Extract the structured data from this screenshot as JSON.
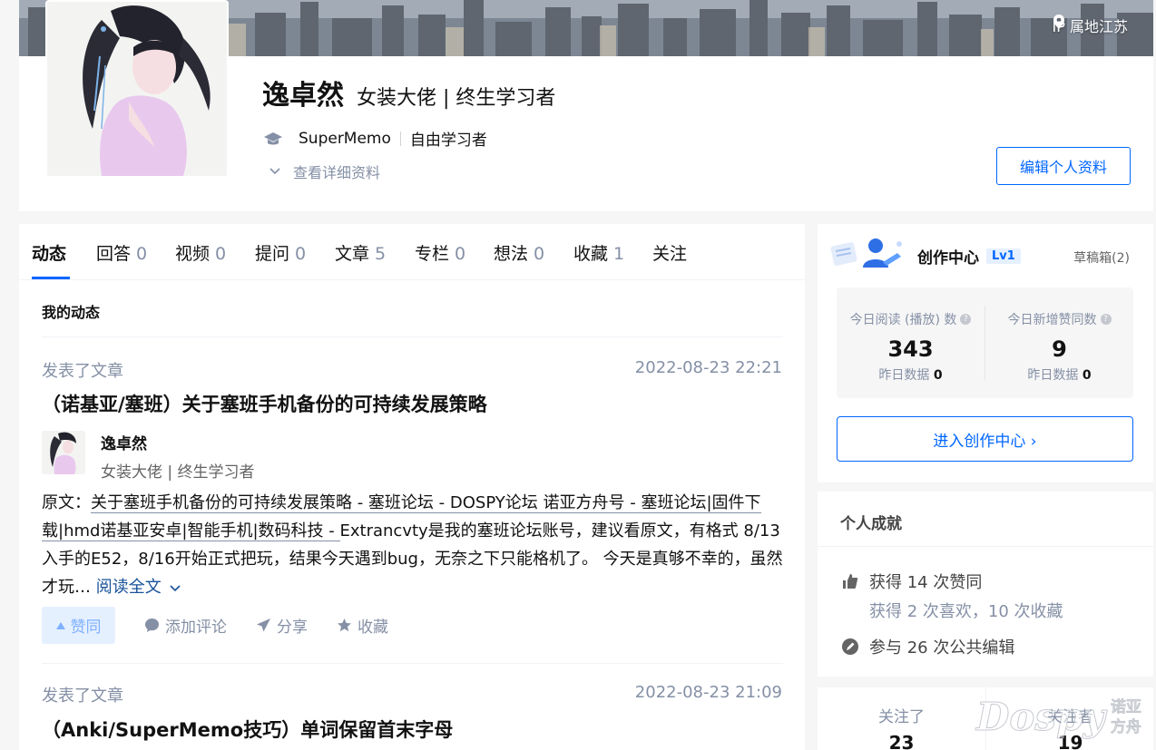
{
  "profile": {
    "ip_location": "IP 属地江苏",
    "name": "逸卓然",
    "headline": "女装大佬 | 终生学习者",
    "school": "SuperMemo",
    "major": "自由学习者",
    "detail_link": "查看详细资料",
    "edit_button": "编辑个人资料"
  },
  "tabs": [
    {
      "label": "动态",
      "count": ""
    },
    {
      "label": "回答",
      "count": "0"
    },
    {
      "label": "视频",
      "count": "0"
    },
    {
      "label": "提问",
      "count": "0"
    },
    {
      "label": "文章",
      "count": "5"
    },
    {
      "label": "专栏",
      "count": "0"
    },
    {
      "label": "想法",
      "count": "0"
    },
    {
      "label": "收藏",
      "count": "1"
    },
    {
      "label": "关注",
      "count": ""
    }
  ],
  "feed": {
    "section_title": "我的动态",
    "items": [
      {
        "action": "发表了文章",
        "time": "2022-08-23 22:21",
        "title": "（诺基亚/塞班）关于塞班手机备份的可持续发展策略",
        "author_name": "逸卓然",
        "author_headline": "女装大佬 | 终生学习者",
        "text_prefix": "原文：",
        "text_link": "关于塞班手机备份的可持续发展策略 - 塞班论坛 - DOSPY论坛 诺亚方舟号 - 塞班论坛|固件下载|hmd诺基亚安卓|智能手机|数码科技 - ",
        "text_body": "Extrancvty是我的塞班论坛账号，建议看原文，有格式 8/13入手的E52，8/16开始正式把玩，结果今天遇到bug，无奈之下只能格机了。 今天是真够不幸的，虽然才玩…",
        "read_more": "阅读全文",
        "vote_label": "赞同",
        "comment_label": "添加评论",
        "share_label": "分享",
        "favorite_label": "收藏"
      },
      {
        "action": "发表了文章",
        "time": "2022-08-23 21:09",
        "title": "（Anki/SuperMemo技巧）单词保留首末字母"
      }
    ]
  },
  "creator": {
    "title": "创作中心",
    "level": "Lv1",
    "drafts": "草稿箱(2)",
    "stats": [
      {
        "label": "今日阅读 (播放) 数",
        "value": "343",
        "sub_label": "昨日数据",
        "sub_value": "0"
      },
      {
        "label": "今日新增赞同数",
        "value": "9",
        "sub_label": "昨日数据",
        "sub_value": "0"
      }
    ],
    "enter_button": "进入创作中心 ›"
  },
  "achievements": {
    "title": "个人成就",
    "likes": "获得 14 次赞同",
    "likes_sub": "获得 2 次喜欢，10 次收藏",
    "edits": "参与 26 次公共编辑"
  },
  "follow": {
    "following_label": "关注了",
    "following_count": "23",
    "followers_label": "关注者",
    "followers_count": "19"
  },
  "watermark": {
    "main": "Dospy",
    "side_line1": "诺亚",
    "side_line2": "方舟"
  },
  "colors": {
    "brand_blue": "#0066ff",
    "muted_text": "#8590a6",
    "link_blue": "#175199",
    "page_bg": "#f6f6f6"
  }
}
